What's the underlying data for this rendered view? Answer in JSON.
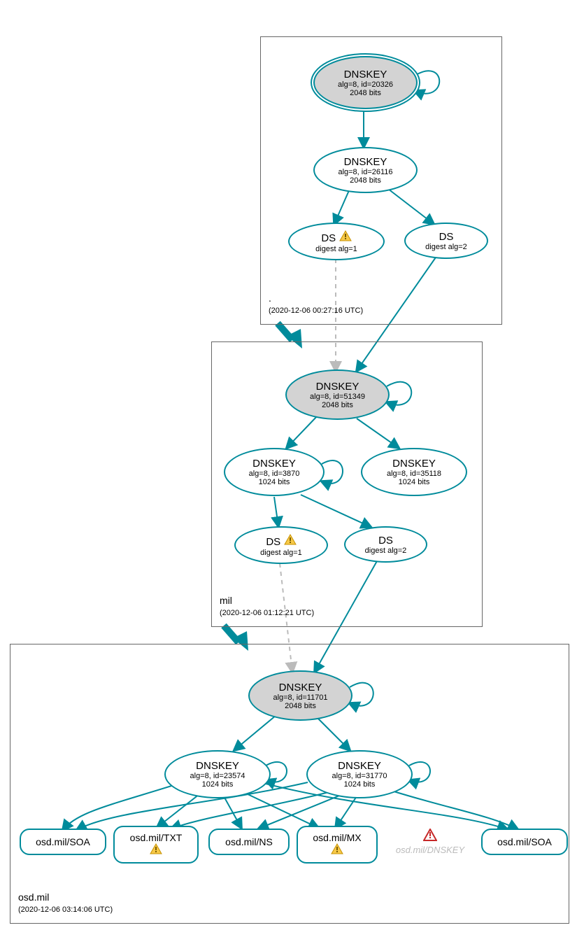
{
  "zones": {
    "root": {
      "name": ".",
      "time": "(2020-12-06 00:27:16 UTC)"
    },
    "mil": {
      "name": "mil",
      "time": "(2020-12-06 01:12:21 UTC)"
    },
    "osd": {
      "name": "osd.mil",
      "time": "(2020-12-06 03:14:06 UTC)"
    }
  },
  "nodes": {
    "root_ksk": {
      "title": "DNSKEY",
      "line1": "alg=8, id=20326",
      "line2": "2048 bits"
    },
    "root_zsk": {
      "title": "DNSKEY",
      "line1": "alg=8, id=26116",
      "line2": "2048 bits"
    },
    "root_ds1": {
      "title": "DS",
      "line1": "digest alg=1"
    },
    "root_ds2": {
      "title": "DS",
      "line1": "digest alg=2"
    },
    "mil_ksk": {
      "title": "DNSKEY",
      "line1": "alg=8, id=51349",
      "line2": "2048 bits"
    },
    "mil_zsk1": {
      "title": "DNSKEY",
      "line1": "alg=8, id=3870",
      "line2": "1024 bits"
    },
    "mil_zsk2": {
      "title": "DNSKEY",
      "line1": "alg=8, id=35118",
      "line2": "1024 bits"
    },
    "mil_ds1": {
      "title": "DS",
      "line1": "digest alg=1"
    },
    "mil_ds2": {
      "title": "DS",
      "line1": "digest alg=2"
    },
    "osd_ksk": {
      "title": "DNSKEY",
      "line1": "alg=8, id=11701",
      "line2": "2048 bits"
    },
    "osd_zsk1": {
      "title": "DNSKEY",
      "line1": "alg=8, id=23574",
      "line2": "1024 bits"
    },
    "osd_zsk2": {
      "title": "DNSKEY",
      "line1": "alg=8, id=31770",
      "line2": "1024 bits"
    },
    "rr_soa1": {
      "title": "osd.mil/SOA"
    },
    "rr_txt": {
      "title": "osd.mil/TXT"
    },
    "rr_ns": {
      "title": "osd.mil/NS"
    },
    "rr_mx": {
      "title": "osd.mil/MX"
    },
    "rr_dnskey_ghost": {
      "title": "osd.mil/DNSKEY"
    },
    "rr_soa2": {
      "title": "osd.mil/SOA"
    }
  }
}
